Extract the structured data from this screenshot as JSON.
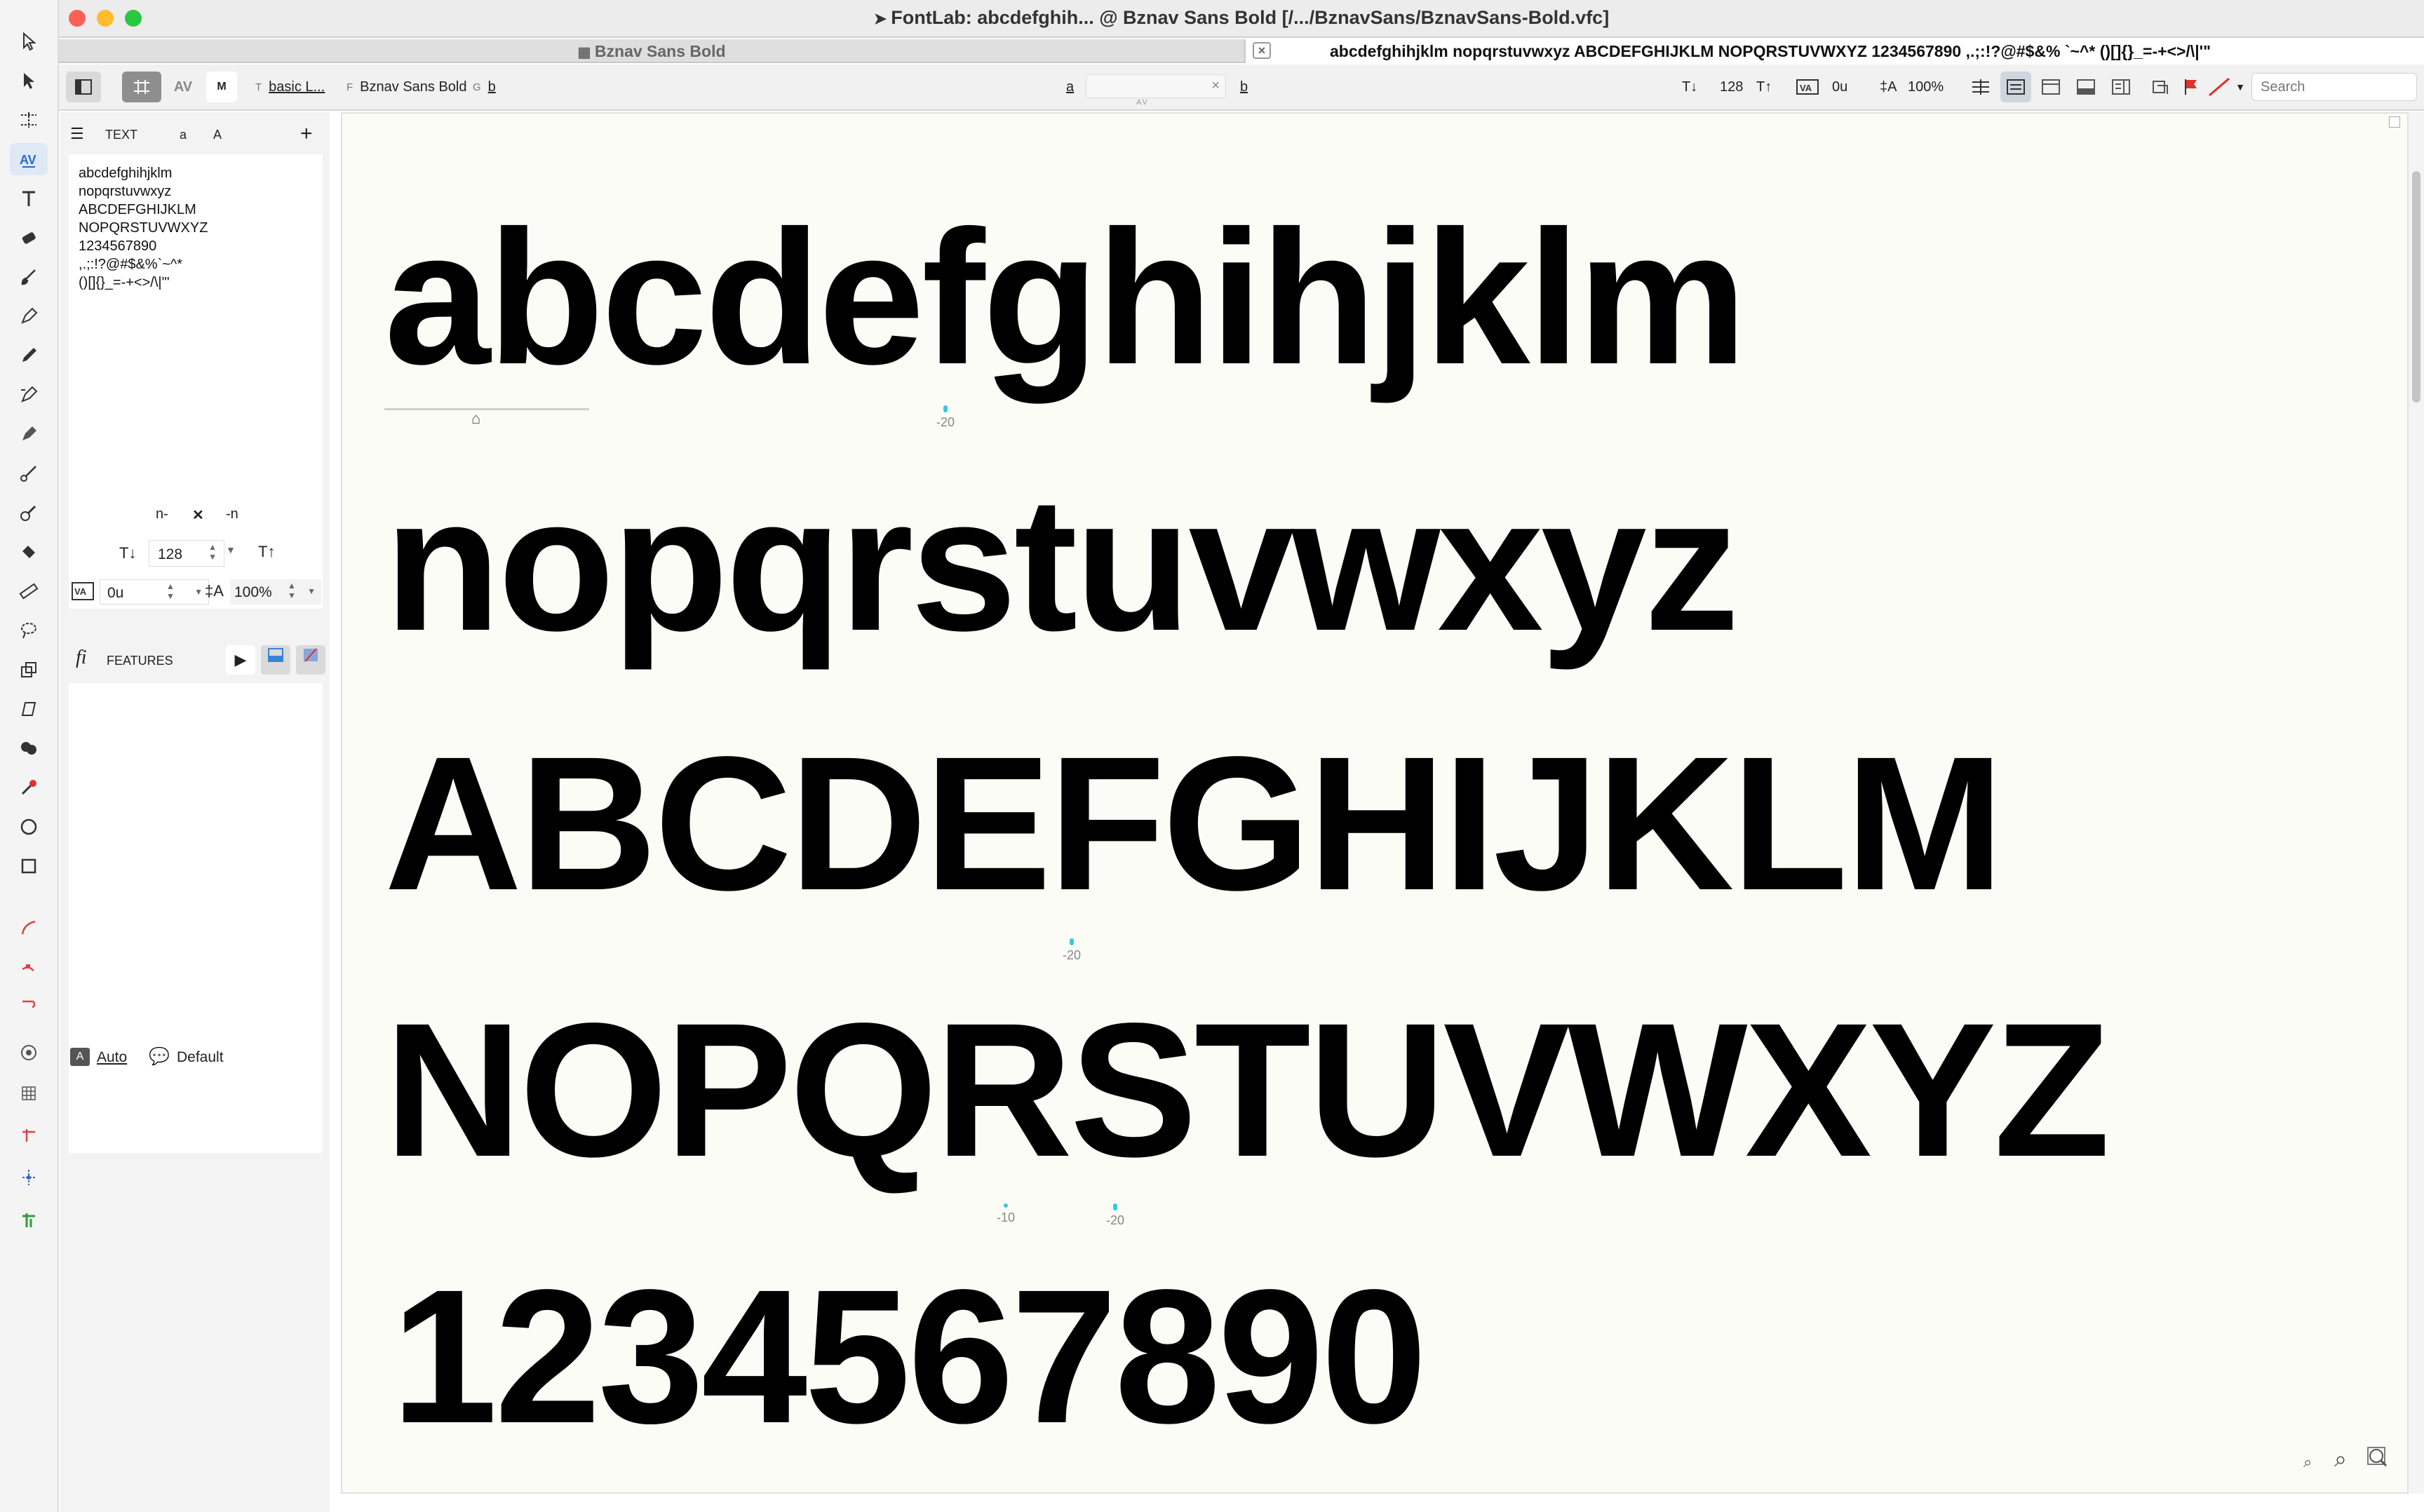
{
  "window": {
    "title": "FontLab: abcdefghih... @ Bznav Sans Bold [/.../BznavSans/BznavSans-Bold.vfc]"
  },
  "tabs": {
    "font_tab": "Bznav Sans Bold",
    "text_tab": "abcdefghihjklm nopqrstuvwxyz ABCDEFGHIJKLM NOPQRSTUVWXYZ 1234567890 ,.;:!?@#$&% `~^* ()[]{}_=-+<>/\\|'\""
  },
  "toolbar": {
    "text_mode_prefix": "T",
    "text_mode_label": "basic L...",
    "font_prefix": "F",
    "font_label": "Bznav Sans Bold",
    "glyph_prefix": "G",
    "glyph_label": "b",
    "pair_left": "a",
    "pair_right": "b",
    "pair_caption": "AV",
    "font_size": "128",
    "tracking": "0u",
    "line_spacing": "100%",
    "search_placeholder": "Search"
  },
  "panel": {
    "text_header": "TEXT",
    "case_lower": "a",
    "case_upper": "A",
    "add": "+",
    "text_lines": [
      "abcdefghihjklm",
      "nopqrstuvwxyz",
      "ABCDEFGHIJKLM",
      "NOPQRSTUVWXYZ",
      "1234567890",
      ",.;:!?@#$&%`~^*",
      "()[]{}_=-+<>/\\|'\""
    ],
    "n_left": "n-",
    "swap": "✕",
    "n_right": "-n",
    "font_size": "128",
    "tracking": "0u",
    "line_spacing": "100%",
    "features_header": "FEATURES",
    "auto_label": "Auto",
    "default_label": "Default"
  },
  "canvas": {
    "lines": [
      "abcdefghihjklm",
      "nopqrstuvwxyz",
      "ABCDEFGHIJKLM",
      "NOPQRSTUVWXYZ",
      "1234567890"
    ],
    "kern_values": {
      "line1_gh": "-20",
      "line3_gh": "-20",
      "line4_pq": "-10",
      "line4_rs": "-20"
    }
  },
  "colors": {
    "canvas_bg": "#fcfcf6",
    "kern_marker": "#35c8e2",
    "close_light": "#fe5f57",
    "min_light": "#febc2e",
    "max_light": "#28c840",
    "flag": "#e0302b"
  }
}
